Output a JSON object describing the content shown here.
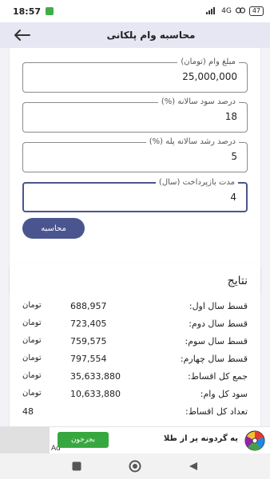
{
  "status_bar": {
    "time": "18:57",
    "network": "4G",
    "battery": "47"
  },
  "app_bar": {
    "title": "محاسبه وام پلکانی"
  },
  "form": {
    "fields": [
      {
        "label": "مبلغ وام (تومان)",
        "value": "25,000,000"
      },
      {
        "label": "درصد سود سالانه (%)",
        "value": "18"
      },
      {
        "label": "درصد رشد سالانه پله (%)",
        "value": "5"
      },
      {
        "label": "مدت بازپرداخت (سال)",
        "value": "4"
      }
    ],
    "calculate_label": "محاسبه"
  },
  "results": {
    "title": "نتایج",
    "currency": "تومان",
    "rows": [
      {
        "label": "قسط سال اول:",
        "value": "688,957"
      },
      {
        "label": "قسط سال دوم:",
        "value": "723,405"
      },
      {
        "label": "قسط سال سوم:",
        "value": "759,575"
      },
      {
        "label": "قسط سال چهارم:",
        "value": "797,554"
      },
      {
        "label": "جمع کل اقساط:",
        "value": "35,633,880"
      },
      {
        "label": "سود کل وام:",
        "value": "10,633,880"
      }
    ],
    "count_row": {
      "label": "تعداد کل اقساط:",
      "value": "48"
    }
  },
  "ad": {
    "tag": "Ad",
    "cta_label": "بجرخون",
    "text": "یه گردونه پر از طلا"
  },
  "colors": {
    "accent": "#4a5590",
    "app_bar_bg": "#e6e7f2",
    "content_bg": "#f3f3f7",
    "ad_cta": "#37a83f"
  }
}
